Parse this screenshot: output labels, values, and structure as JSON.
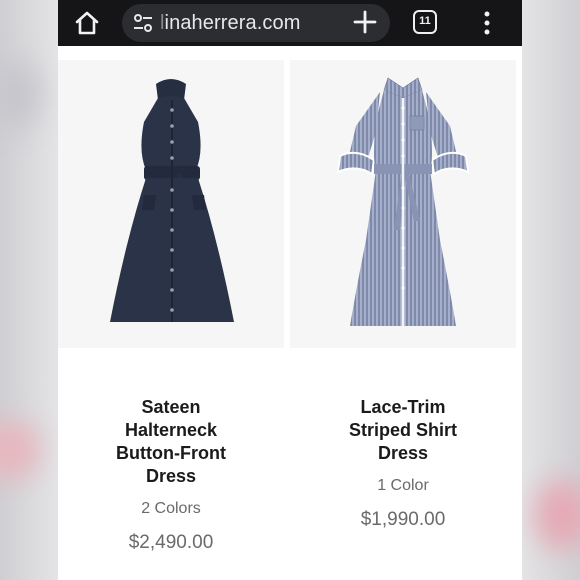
{
  "browser": {
    "url_faded": "l",
    "url_main": "inaherrera.com",
    "tab_count": "11",
    "icons": [
      "home-icon",
      "site-settings-icon",
      "new-tab-icon",
      "tab-switcher-icon",
      "menu-icon"
    ]
  },
  "products": [
    {
      "name": "Sateen Halterneck Button-Front Dress",
      "colors": "2 Colors",
      "price": "$2,490.00"
    },
    {
      "name": "Lace-Trim Striped Shirt Dress",
      "colors": "1 Color",
      "price": "$1,990.00"
    }
  ],
  "colors": {
    "toolbar": "#151517",
    "url_pill": "#2c2d31",
    "navy_dress": "#2a3348",
    "striped_dress": "#8e9ab8"
  }
}
